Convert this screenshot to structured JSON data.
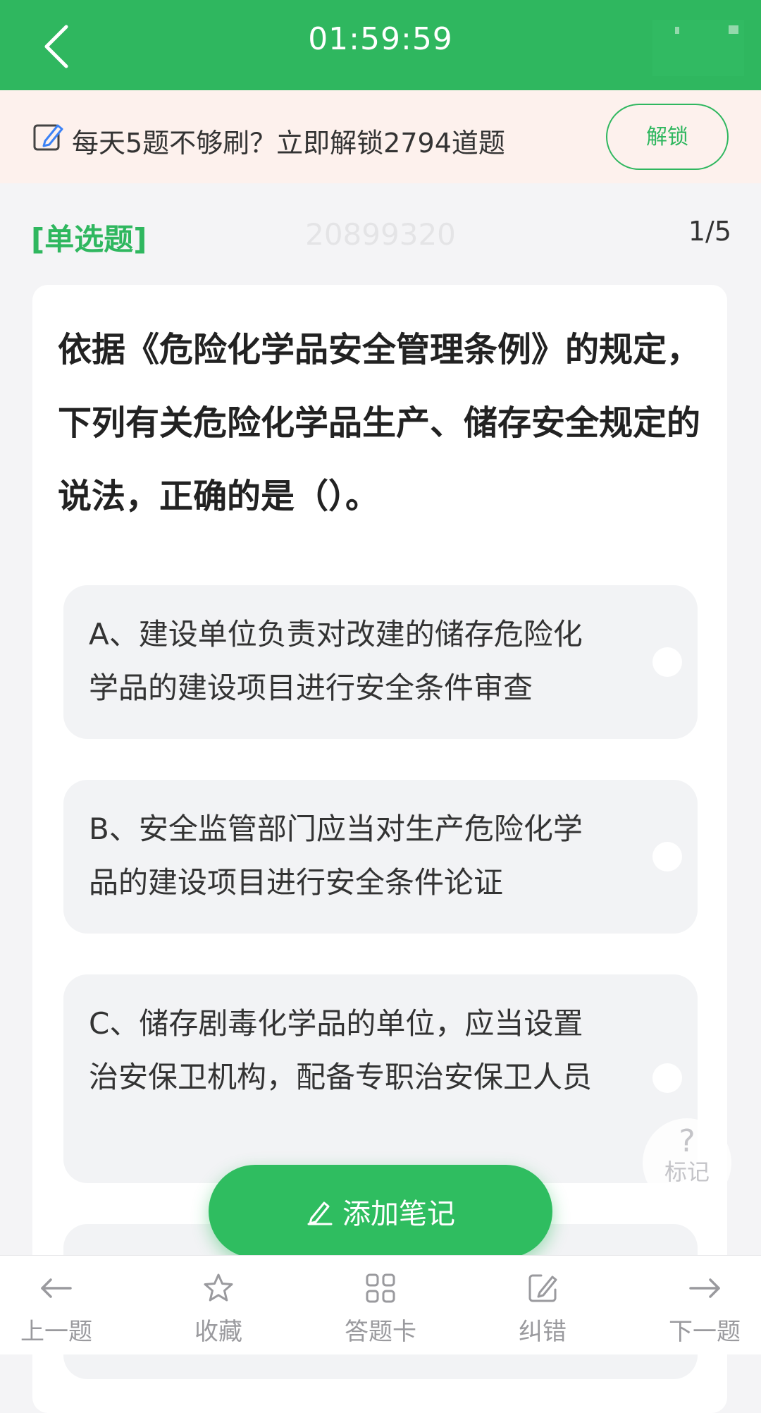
{
  "header": {
    "timer": "01:59:59"
  },
  "promo": {
    "text": "每天5题不够刷？立即解锁2794道题",
    "unlock_label": "解锁"
  },
  "question": {
    "type": "[单选题]",
    "id": "20899320",
    "progress": "1/5",
    "text": "依据《危险化学品安全管理条例》的规定，下列有关危险化学品生产、储存安全规定的说法，正确的是（）。",
    "options": [
      {
        "text": "A、建设单位负责对改建的储存危险化学品的建设项目进行安全条件审查"
      },
      {
        "text": "B、安全监管部门应当对生产危险化学品的建设项目进行安全条件论证"
      },
      {
        "text": "C、储存剧毒化学品的单位，应当设置治安保卫机构，配备专职治安保卫人员"
      }
    ]
  },
  "mark": {
    "symbol": "?",
    "label": "标记"
  },
  "add_note_label": "添加笔记",
  "bottom_nav": {
    "prev": "上一题",
    "favorite": "收藏",
    "answer_card": "答题卡",
    "report_error": "纠错",
    "next": "下一题"
  },
  "colors": {
    "brand_green": "#2fb75f",
    "promo_bg": "#fdf1ed",
    "page_bg": "#f4f4f6"
  }
}
